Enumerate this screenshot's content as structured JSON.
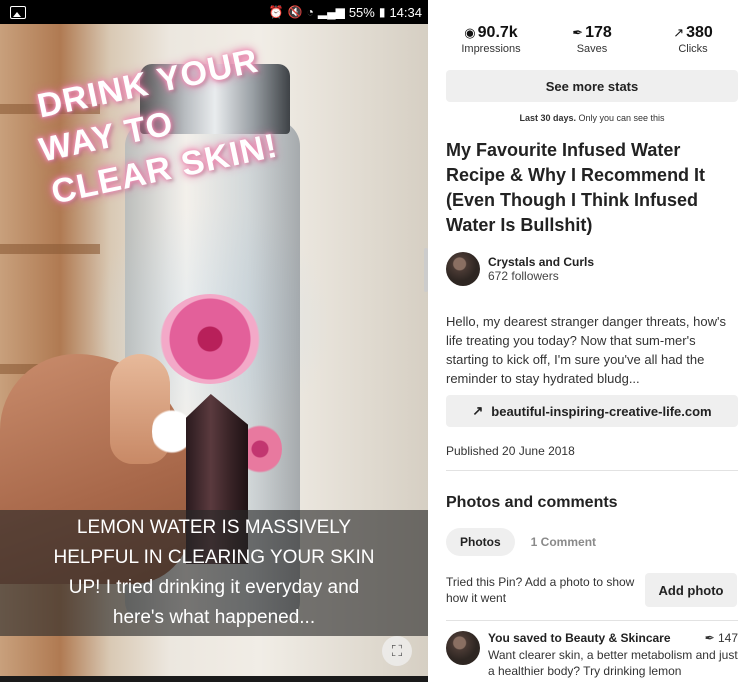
{
  "status_bar": {
    "battery": "55%",
    "time": "14:34"
  },
  "pin_image": {
    "overlay_lines": [
      "DRINK YOUR",
      "WAY TO",
      "CLEAR SKIN!"
    ],
    "caption_lines": [
      "LEMON WATER IS MASSIVELY",
      "HELPFUL IN CLEARING YOUR SKIN",
      "UP! I tried drinking it everyday and",
      "here's what happened..."
    ]
  },
  "stats": [
    {
      "icon": "eye-icon",
      "value": "90.7k",
      "label": "Impressions"
    },
    {
      "icon": "pin-icon",
      "value": "178",
      "label": "Saves"
    },
    {
      "icon": "arrow-up-right-icon",
      "value": "380",
      "label": "Clicks"
    }
  ],
  "see_more_stats": "See more stats",
  "period": {
    "bold": "Last 30 days.",
    "rest": "Only you can see this"
  },
  "pin_title": "My Favourite Infused Water Recipe & Why I Recommend It (Even Though I Think Infused Water Is Bullshit)",
  "author": {
    "name": "Crystals and Curls",
    "followers": "672 followers"
  },
  "description": "Hello, my dearest stranger danger threats, how's life treating you today? Now that sum-mer's starting to kick off, I'm sure you've all had the reminder to stay hydrated bludg...",
  "link": "beautiful-inspiring-creative-life.com",
  "published": "Published 20 June 2018",
  "photos_comments": {
    "title": "Photos and comments",
    "tab_photos": "Photos",
    "tab_comments": "1 Comment",
    "tried_text": "Tried this Pin? Add a photo to show how it went",
    "add_photo": "Add photo"
  },
  "activity": {
    "prefix": "You saved to",
    "board": "Beauty & Skincare",
    "count": "147",
    "text": "Want clearer skin, a better metabolism and just a healthier body? Try drinking lemon"
  }
}
